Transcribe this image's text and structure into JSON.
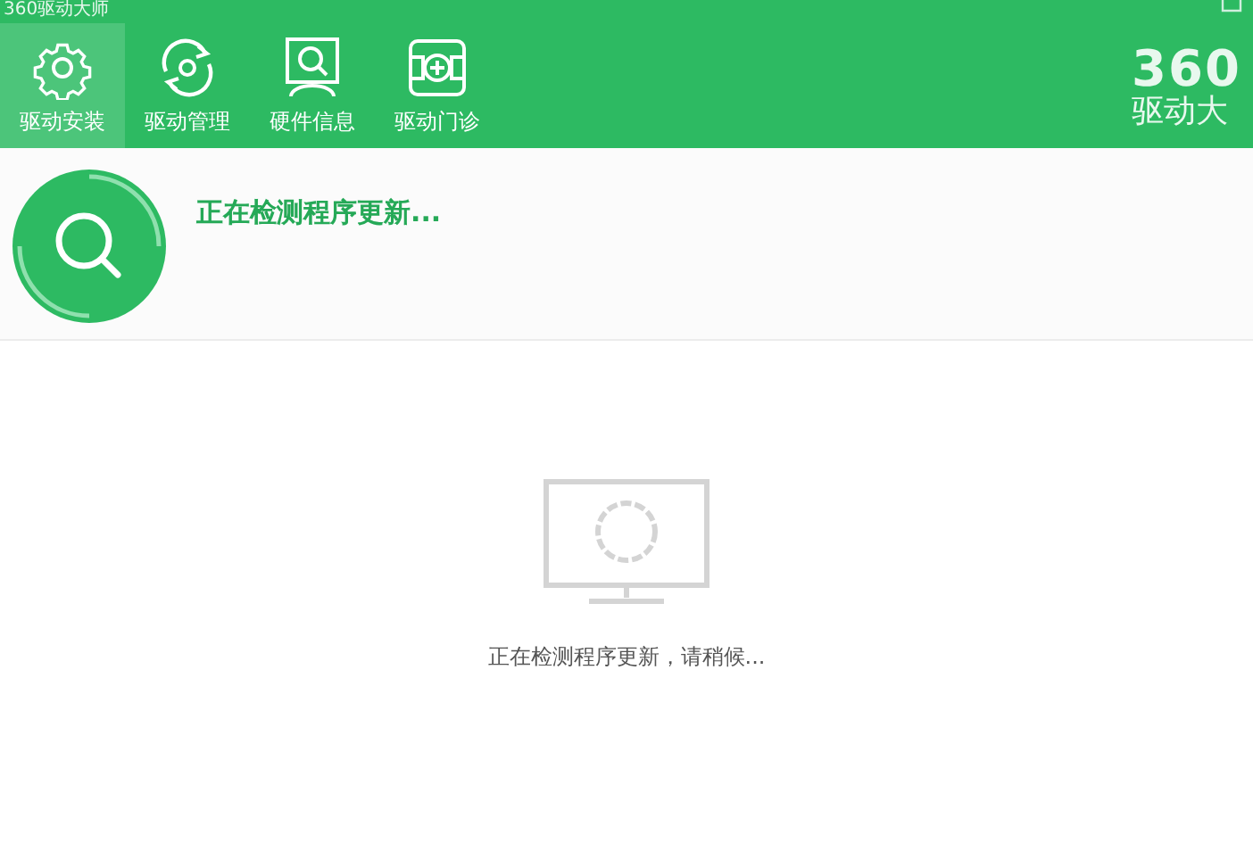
{
  "window": {
    "title": "360驱动大师"
  },
  "tabs": [
    {
      "label": "驱动安装",
      "selected": true,
      "kind": "gear"
    },
    {
      "label": "驱动管理",
      "selected": false,
      "kind": "refresh"
    },
    {
      "label": "硬件信息",
      "selected": false,
      "kind": "monitor"
    },
    {
      "label": "驱动门诊",
      "selected": false,
      "kind": "medical"
    }
  ],
  "logo": {
    "number": "360",
    "name": "驱动大"
  },
  "banner": {
    "status": "正在检测程序更新..."
  },
  "main": {
    "message": "正在检测程序更新，请稍候..."
  }
}
